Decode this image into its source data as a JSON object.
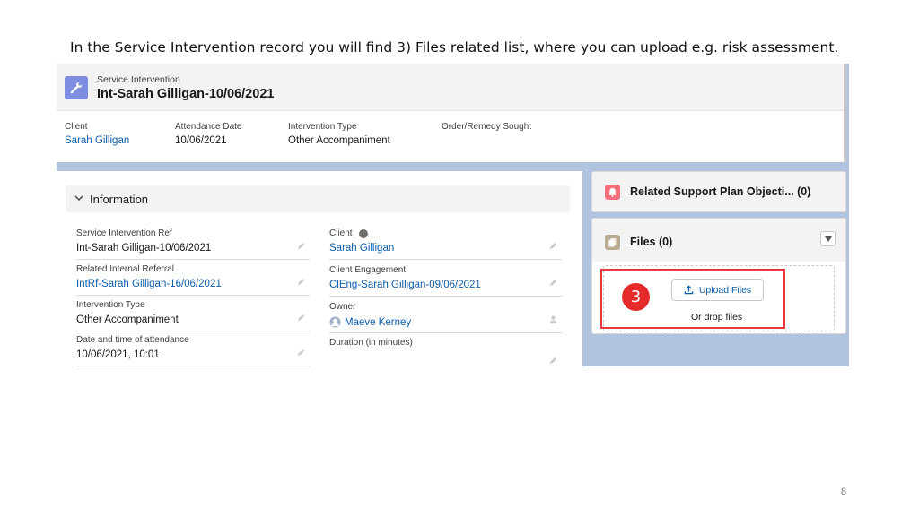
{
  "caption": "In the Service Intervention record you will find 3) Files related list, where you can upload e.g. risk assessment.",
  "slide_number": "8",
  "record": {
    "object_type": "Service Intervention",
    "title": "Int-Sarah Gilligan-10/06/2021",
    "icon": "wrench-icon",
    "highlights": [
      {
        "label": "Client",
        "value": "Sarah Gilligan",
        "is_link": true
      },
      {
        "label": "Attendance Date",
        "value": "10/06/2021",
        "is_link": false
      },
      {
        "label": "Intervention Type",
        "value": "Other Accompaniment",
        "is_link": false
      },
      {
        "label": "Order/Remedy Sought",
        "value": "",
        "is_link": false
      }
    ]
  },
  "information": {
    "section_title": "Information",
    "left_fields": [
      {
        "label": "Service Intervention Ref",
        "value": "Int-Sarah Gilligan-10/06/2021",
        "is_link": false
      },
      {
        "label": "Related Internal Referral",
        "value": "IntRf-Sarah Gilligan-16/06/2021",
        "is_link": true
      },
      {
        "label": "Intervention Type",
        "value": "Other Accompaniment",
        "is_link": false
      },
      {
        "label": "Date and time of attendance",
        "value": "10/06/2021, 10:01",
        "is_link": false
      }
    ],
    "right_fields": [
      {
        "label": "Client",
        "value": "Sarah Gilligan",
        "is_link": true
      },
      {
        "label": "Client Engagement",
        "value": "ClEng-Sarah Gilligan-09/06/2021",
        "is_link": true
      },
      {
        "label": "Owner",
        "value": "Maeve Kerney",
        "is_link": true
      },
      {
        "label": "Duration (in minutes)",
        "value": "",
        "is_link": false
      }
    ]
  },
  "related": {
    "support_plan_title": "Related Support Plan Objecti... (0)",
    "files_title": "Files (0)",
    "upload_button": "Upload Files",
    "drop_text": "Or drop files"
  },
  "annotation": {
    "step_number": "3",
    "color": "#e42a2a"
  }
}
